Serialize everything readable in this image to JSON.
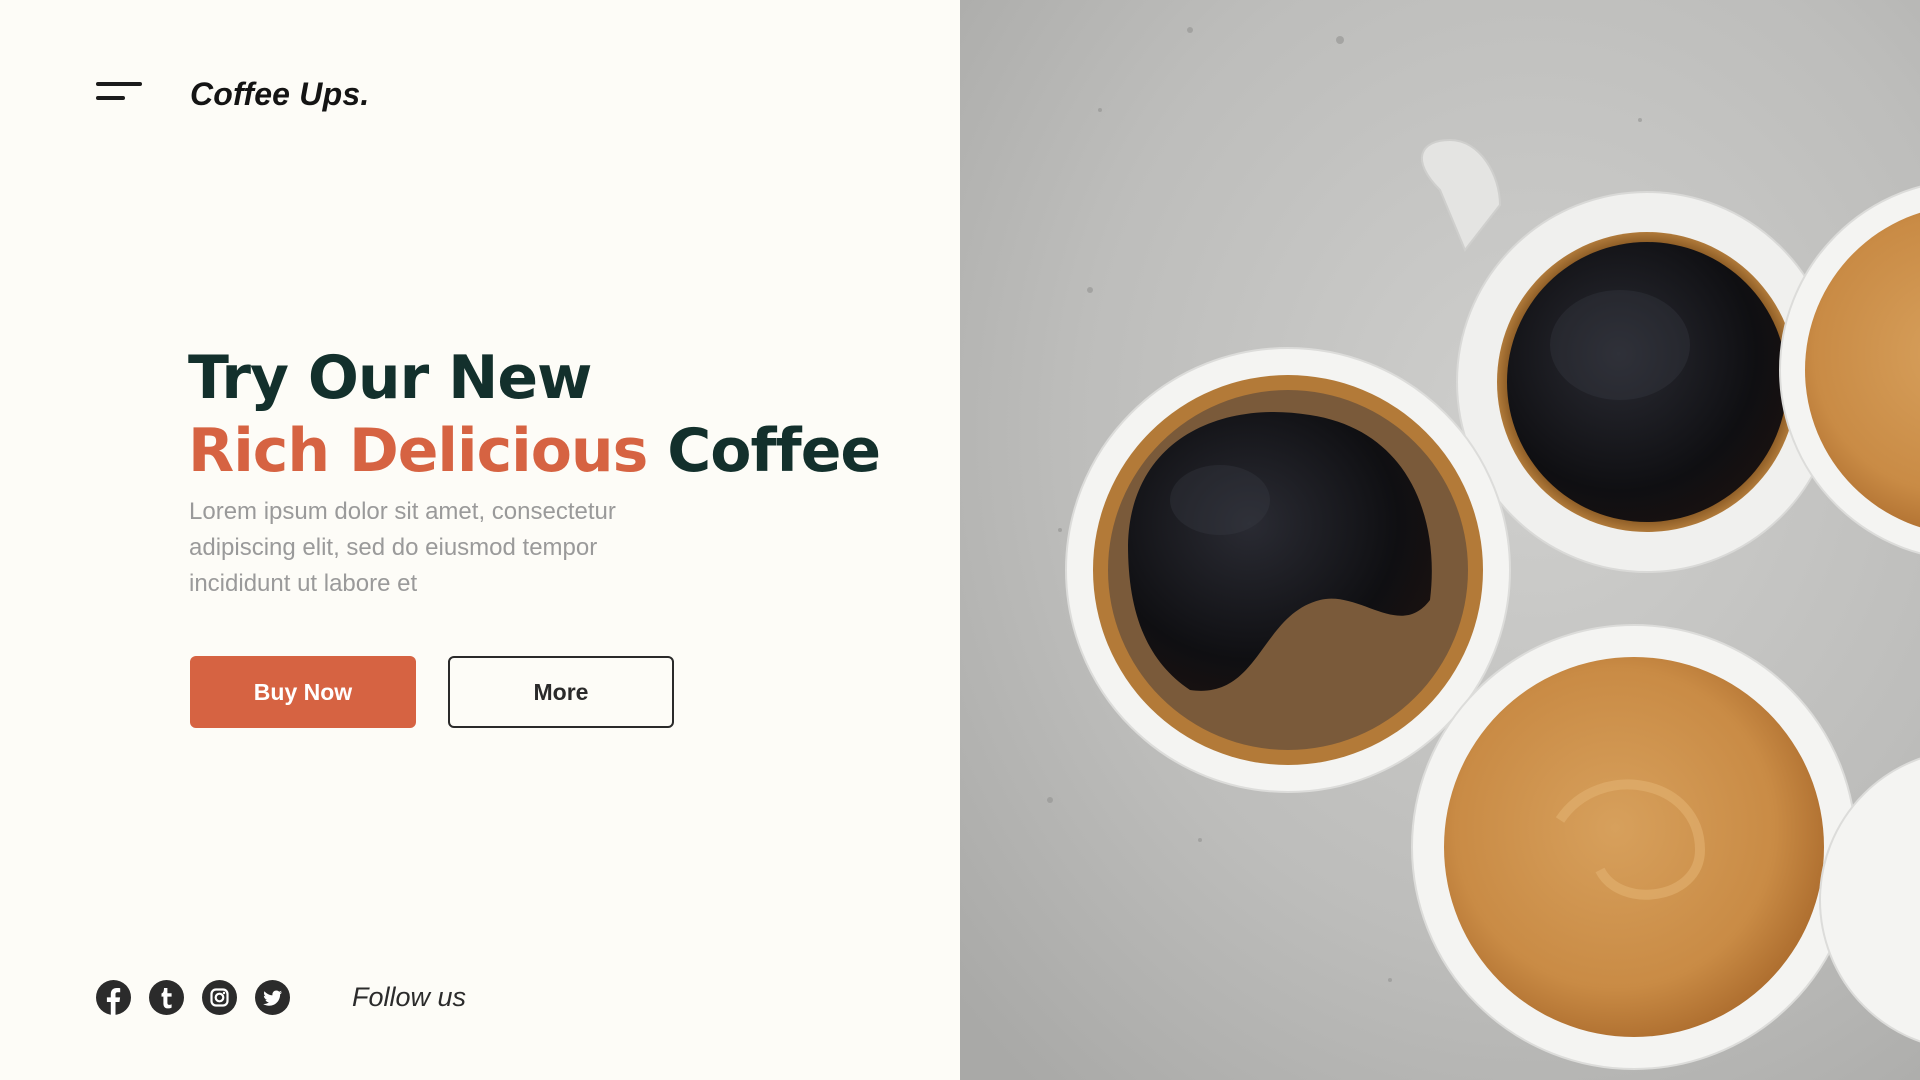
{
  "brand": {
    "name": "Coffee Ups."
  },
  "hero": {
    "line1": "Try Our New",
    "line2_accent": "Rich Delicious",
    "line2_rest": " Coffee",
    "description": "Lorem ipsum dolor sit amet, consectetur adipiscing elit, sed do eiusmod tempor incididunt ut labore et"
  },
  "buttons": {
    "buy": "Buy Now",
    "more": "More"
  },
  "social": {
    "icons": [
      "facebook-icon",
      "tumblr-icon",
      "instagram-icon",
      "twitter-icon"
    ],
    "follow": "Follow us"
  },
  "colors": {
    "background": "#fdfcf7",
    "accent": "#d66342",
    "heading": "#13302c",
    "body_text": "#9a9a9a",
    "dark": "#2b2b2b",
    "photo_background": "#bdbdbb"
  },
  "image": {
    "description": "coffee-cups-on-concrete"
  }
}
